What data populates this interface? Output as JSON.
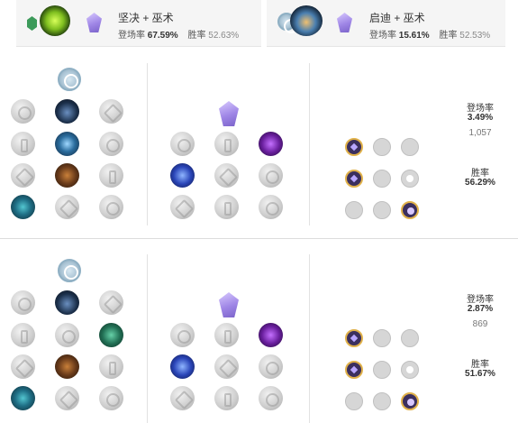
{
  "builds": [
    {
      "title": "坚决 + 巫术",
      "pick_label": "登场率",
      "pick_rate": "67.59%",
      "win_label": "胜率",
      "win_rate": "52.63%"
    },
    {
      "title": "启迪 + 巫术",
      "pick_label": "登场率",
      "pick_rate": "15.61%",
      "win_label": "胜率",
      "win_rate": "52.53%"
    }
  ],
  "pages": [
    {
      "pick_label": "登场率",
      "pick_rate": "3.49%",
      "games": "1,057",
      "win_label": "胜率",
      "win_rate": "56.29%"
    },
    {
      "pick_label": "登场率",
      "pick_rate": "2.87%",
      "games": "869",
      "win_label": "胜率",
      "win_rate": "51.67%"
    }
  ],
  "colors": {
    "card_bg": "#f5f5f5",
    "rune_gray": "#cfcfcf",
    "sorcery_accent": "#9f86e6",
    "shard_active_border": "#e0b14a"
  },
  "icons": {
    "resolve_tree": "resolve-green-icon",
    "inspiration_tree": "inspiration-icon",
    "sorcery_tree": "sorcery-gem-icon"
  }
}
